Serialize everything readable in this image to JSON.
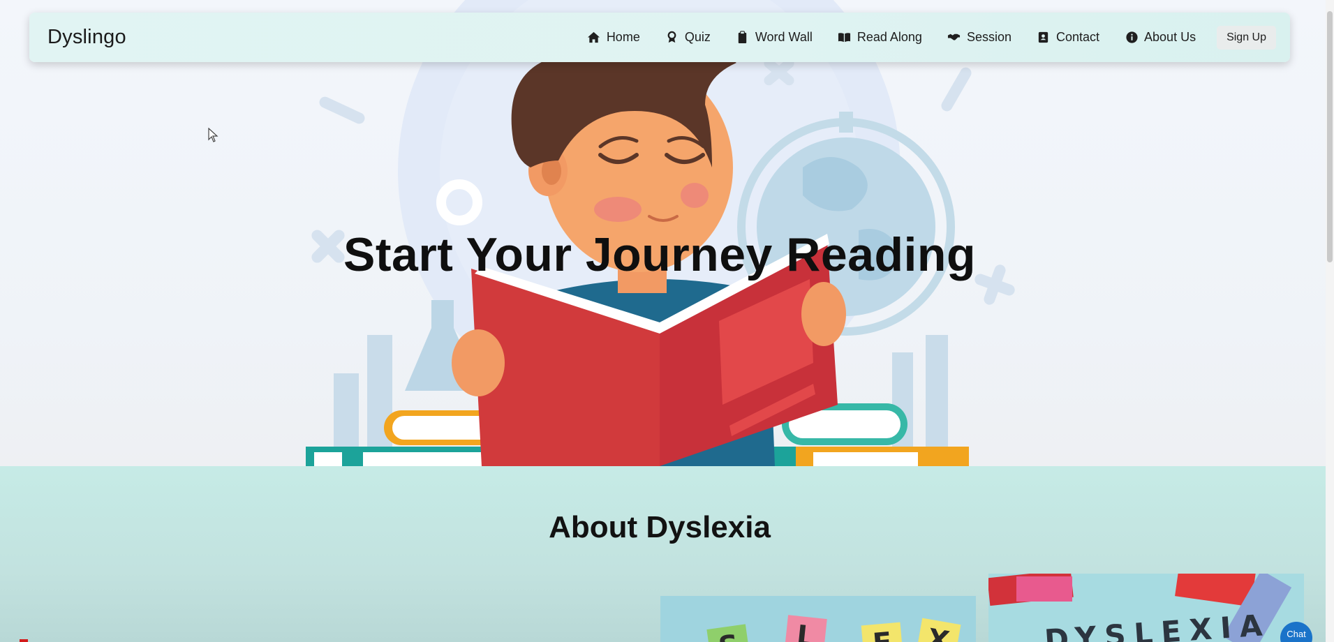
{
  "brand": "Dyslingo",
  "nav": {
    "items": [
      {
        "label": "Home",
        "icon": "home-icon"
      },
      {
        "label": "Quiz",
        "icon": "award-icon"
      },
      {
        "label": "Word Wall",
        "icon": "clipboard-icon"
      },
      {
        "label": "Read Along",
        "icon": "book-open-icon"
      },
      {
        "label": "Session",
        "icon": "handshake-icon"
      },
      {
        "label": "Contact",
        "icon": "contact-book-icon"
      },
      {
        "label": "About Us",
        "icon": "info-circle-icon"
      }
    ],
    "signup_label": "Sign Up"
  },
  "hero": {
    "title": "Start Your Journey Reading"
  },
  "about": {
    "title": "About Dyslexia",
    "card2_word": "DYSLEXIA"
  },
  "chat": {
    "label": "Chat"
  },
  "colors": {
    "navbar_bg": "#dff3f2",
    "about_bg": "#c6ebe6",
    "book_red": "#d0363a",
    "accent_blue": "#1a73c9"
  }
}
